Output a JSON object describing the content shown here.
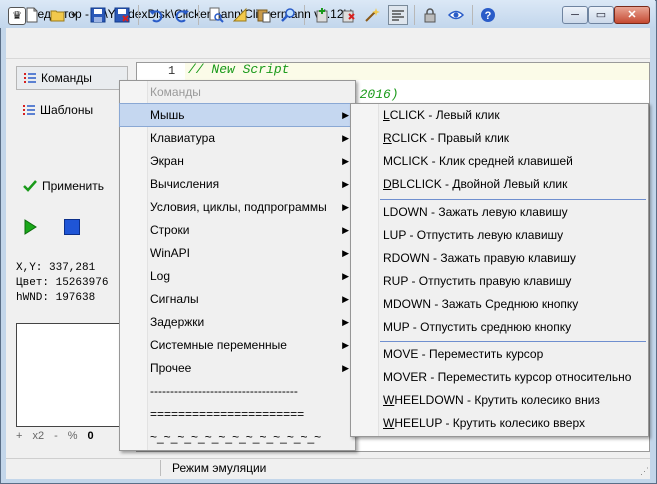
{
  "window": {
    "title": "Редактор - D:\\YandexDisk\\Clickermann\\Clickermann v4.12b\\",
    "app_icon": "app-icon",
    "min_label": "─",
    "max_label": "▭",
    "close_label": "✕"
  },
  "toolbar": {
    "buttons": [
      "new-file-icon",
      "open-folder-icon",
      "dropdown-arrow-icon",
      "save-icon",
      "save-as-icon",
      "undo-icon",
      "redo-icon",
      "find-icon",
      "ruler-icon",
      "paste-icon",
      "search-icon",
      "add-icon",
      "delete-icon",
      "magic-wand-icon",
      "format-icon",
      "lock-icon",
      "eye-icon",
      "help-icon"
    ]
  },
  "sidebar": {
    "commands_tab": "Команды",
    "templates_tab": "Шаблоны",
    "apply_label": "Применить"
  },
  "info": {
    "xy": "X,Y:  337,281",
    "color": "Цвет: 15263976",
    "hwnd": "hWND: 197638"
  },
  "zoom": {
    "plus": "+",
    "x2": "x2",
    "minus": "-",
    "percent": "%",
    "zero": "0"
  },
  "editor": {
    "line_number": "1",
    "line1": "// New Script",
    "line2_tail": "2.2016)"
  },
  "status": {
    "mode": "Режим эмуляции"
  },
  "menu": {
    "header": "Команды",
    "items": [
      {
        "label": "Мышь",
        "arrow": "▶"
      },
      {
        "label": "Клавиатура",
        "arrow": "▶"
      },
      {
        "label": "Экран",
        "arrow": "▶"
      },
      {
        "label": "Вычисления",
        "arrow": "▶"
      },
      {
        "label": "Условия, циклы, подпрограммы",
        "arrow": "▶"
      },
      {
        "label": "Строки",
        "arrow": "▶"
      },
      {
        "label": "WinAPI",
        "arrow": "▶"
      },
      {
        "label": "Log",
        "arrow": "▶"
      },
      {
        "label": "Сигналы",
        "arrow": "▶"
      },
      {
        "label": "Задержки",
        "arrow": "▶"
      },
      {
        "label": "Системные переменные",
        "arrow": "▶"
      },
      {
        "label": "Прочее",
        "arrow": "▶"
      }
    ],
    "sep_dashes": "-------------------------------------",
    "sep_equals": "======================",
    "sep_tilde": "~_~_~_~_~_~_~_~_~_~_~_~_~"
  },
  "submenu": {
    "items": [
      {
        "key": "LCLICK",
        "u": "L",
        "rest": "CLICK",
        "desc": " - Левый клик"
      },
      {
        "key": "RCLICK",
        "u": "R",
        "rest": "CLICK",
        "desc": " - Правый клик"
      },
      {
        "key": "MCLICK",
        "u": "",
        "rest": "MCLICK",
        "desc": " - Клик средней клавишей"
      },
      {
        "key": "DBLCLICK",
        "u": "D",
        "rest": "BLCLICK",
        "desc": " - Двойной Левый клик"
      },
      {
        "key": "LDOWN",
        "u": "",
        "rest": "LDOWN",
        "desc": " - Зажать левую клавишу"
      },
      {
        "key": "LUP",
        "u": "",
        "rest": "LUP",
        "desc": " - Отпустить левую клавишу"
      },
      {
        "key": "RDOWN",
        "u": "",
        "rest": "RDOWN",
        "desc": " - Зажать правую клавишу"
      },
      {
        "key": "RUP",
        "u": "",
        "rest": "RUP",
        "desc": " - Отпустить правую клавишу"
      },
      {
        "key": "MDOWN",
        "u": "",
        "rest": "MDOWN",
        "desc": " - Зажать Среднюю кнопку"
      },
      {
        "key": "MUP",
        "u": "",
        "rest": "MUP",
        "desc": " - Отпустить среднюю кнопку"
      },
      {
        "key": "MOVE",
        "u": "",
        "rest": "MOVE",
        "desc": " - Переместить курсор"
      },
      {
        "key": "MOVER",
        "u": "",
        "rest": "MOVER",
        "desc": " - Переместить курсор относительно"
      },
      {
        "key": "WHEELDOWN",
        "u": "W",
        "rest": "HEELDOWN",
        "desc": " - Крутить колесико вниз"
      },
      {
        "key": "WHEELUP",
        "u": "W",
        "rest": "HEELUP",
        "desc": " - Крутить колесико вверх"
      }
    ]
  }
}
